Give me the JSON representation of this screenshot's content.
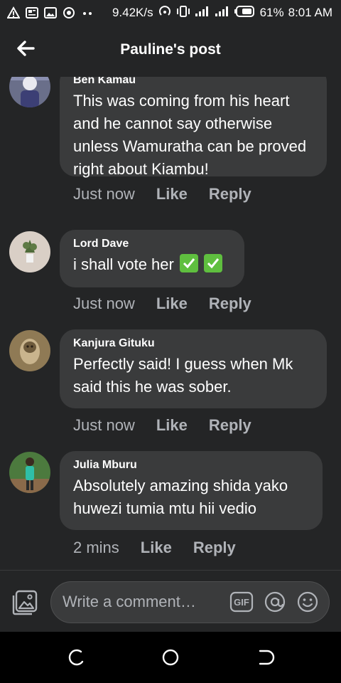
{
  "status_bar": {
    "net_speed": "9.42K/s",
    "battery_percent": "61%",
    "time": "8:01 AM"
  },
  "header": {
    "title": "Pauline's post"
  },
  "comments": [
    {
      "author": "Ben Kamau",
      "text": "This was coming from his heart and he cannot say otherwise unless Wamuratha can be proved right about Kiambu!",
      "time": "Just now",
      "like": "Like",
      "reply": "Reply"
    },
    {
      "author": "Lord Dave",
      "text": "i shall vote her",
      "time": "Just now",
      "like": "Like",
      "reply": "Reply"
    },
    {
      "author": "Kanjura Gituku",
      "text": "Perfectly said! I guess when Mk said this he was sober.",
      "time": "Just now",
      "like": "Like",
      "reply": "Reply"
    },
    {
      "author": "Julia Mburu",
      "text": "Absolutely amazing shida yako huwezi tumia mtu hii vedio",
      "time": "2 mins",
      "like": "Like",
      "reply": "Reply"
    }
  ],
  "composer": {
    "placeholder": "Write a comment…",
    "gif_label": "GIF"
  },
  "colors": {
    "background": "#242526",
    "bubble": "#3a3b3c",
    "secondary_text": "#b0b3b8",
    "checkmark": "#5fbf3f"
  }
}
